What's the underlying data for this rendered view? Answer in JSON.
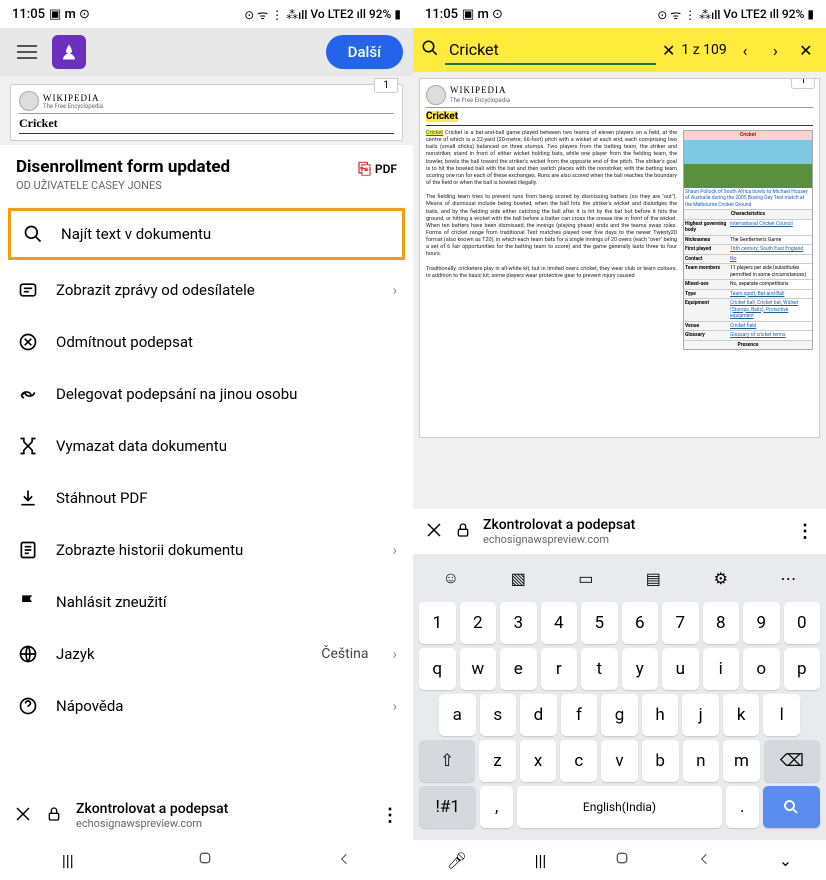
{
  "status": {
    "time": "11:05",
    "battery": "92%",
    "net": "LTE2",
    "vo": "Vo"
  },
  "left": {
    "next": "Další",
    "doc_site": "WIKIPEDIA",
    "doc_sub": "The Free Encyclopedia",
    "doc_title": "Cricket",
    "page": "1",
    "section_title": "Disenrollment form updated",
    "section_sub": "OD UŽIVATELE CASEY JONES",
    "pdf": "PDF",
    "menu": {
      "find": "Najít text v dokumentu",
      "messages": "Zobrazit zprávy od odesílatele",
      "decline": "Odmítnout podepsat",
      "delegate": "Delegovat podepsání na jinou osobu",
      "clear": "Vymazat data dokumentu",
      "download": "Stáhnout PDF",
      "history": "Zobrazte historii dokumentu",
      "report": "Nahlásit zneužití",
      "lang": "Jazyk",
      "lang_val": "Čeština",
      "help": "Nápověda"
    },
    "bottom": {
      "title": "Zkontrolovat a podepsat",
      "url": "echosignawspreview.com"
    }
  },
  "right": {
    "search_value": "Cricket",
    "search_count": "1 z 109",
    "doc_site": "WIKIPEDIA",
    "doc_sub": "The Free Encyclopedia",
    "doc_title": "Cricket",
    "page": "1",
    "para1": "Cricket is a bat-and-ball game played between two teams of eleven players on a field, at the centre of which is a 22-yard (20-metre; 66-foot) pitch with a wicket at each end, each comprising two bails (small sticks) balanced on three stumps. Two players from the batting team, the striker and nonstriker, stand in front of either wicket holding bats, while one player from the fielding team, the bowler, bowls the ball toward the striker's wicket from the opposite end of the pitch. The striker's goal is to hit the bowled ball with the bat and then switch places with the nonstriker, with the batting team scoring one run for each of these exchanges. Runs are also scored when the ball reaches the boundary of the field or when the ball is bowled illegally.",
    "para2": "The fielding team tries to prevent runs from being scored by dismissing batters (so they are \"out\"). Means of dismissal include being bowled, when the ball hits the striker's wicket and dislodges the bails, and by the fielding side either catching the ball after it is hit by the bat but before it hits the ground, or hitting a wicket with the ball before a batter can cross the crease line in front of the wicket. When ten batters have been dismissed, the innings (playing phase) ends and the teams swap roles. Forms of cricket range from traditional Test matches played over five days to the newer Twenty20 format (also known as T20), in which each team bats for a single innings of 20 overs (each \"over\" being a set of 6 fair opportunities for the batting team to score) and the game generally lasts three to four hours.",
    "para3": "Traditionally, cricketers play in all-white kit, but in limited overs cricket, they wear club or team colours. In addition to the basic kit, some players wear protective gear to prevent injury caused",
    "infobox": {
      "title": "Cricket",
      "caption": "Shaun Pollock of South Africa bowls to Michael Hussey of Australia during the 2005 Boxing Day Test match at the Melbourne Cricket Ground",
      "char": "Characteristics",
      "gov_k": "Highest governing body",
      "gov_v": "International Cricket Council",
      "nick_k": "Nicknames",
      "nick_v": "The Gentlemen's Game",
      "first_k": "First played",
      "first_v": "16th century; South East England",
      "contact_k": "Contact",
      "contact_v": "No",
      "team_k": "Team members",
      "team_v": "11 players per side (substitutes permitted in some circumstances)",
      "mixed_k": "Mixed-sex",
      "mixed_v": "No, separate competitions",
      "type_k": "Type",
      "type_v": "Team sport, Bat-and-Ball",
      "equip_k": "Equipment",
      "equip_v": "Cricket ball, Cricket bat, Wicket (Stumps, Bails), Protective equipment",
      "venue_k": "Venue",
      "venue_v": "Cricket field",
      "gloss_k": "Glossary",
      "gloss_v": "Glossary of cricket terms",
      "presence": "Presence"
    },
    "kb_bar": {
      "title": "Zkontrolovat a podepsat",
      "url": "echosignawspreview.com"
    },
    "kb": {
      "row1": [
        "1",
        "2",
        "3",
        "4",
        "5",
        "6",
        "7",
        "8",
        "9",
        "0"
      ],
      "row2": [
        "q",
        "w",
        "e",
        "r",
        "t",
        "y",
        "u",
        "i",
        "o",
        "p"
      ],
      "row3": [
        "a",
        "s",
        "d",
        "f",
        "g",
        "h",
        "j",
        "k",
        "l"
      ],
      "row4": [
        "z",
        "x",
        "c",
        "v",
        "b",
        "n",
        "m"
      ],
      "sym": "!#1",
      "comma": ",",
      "space": "English(India)",
      "dot": "."
    }
  }
}
